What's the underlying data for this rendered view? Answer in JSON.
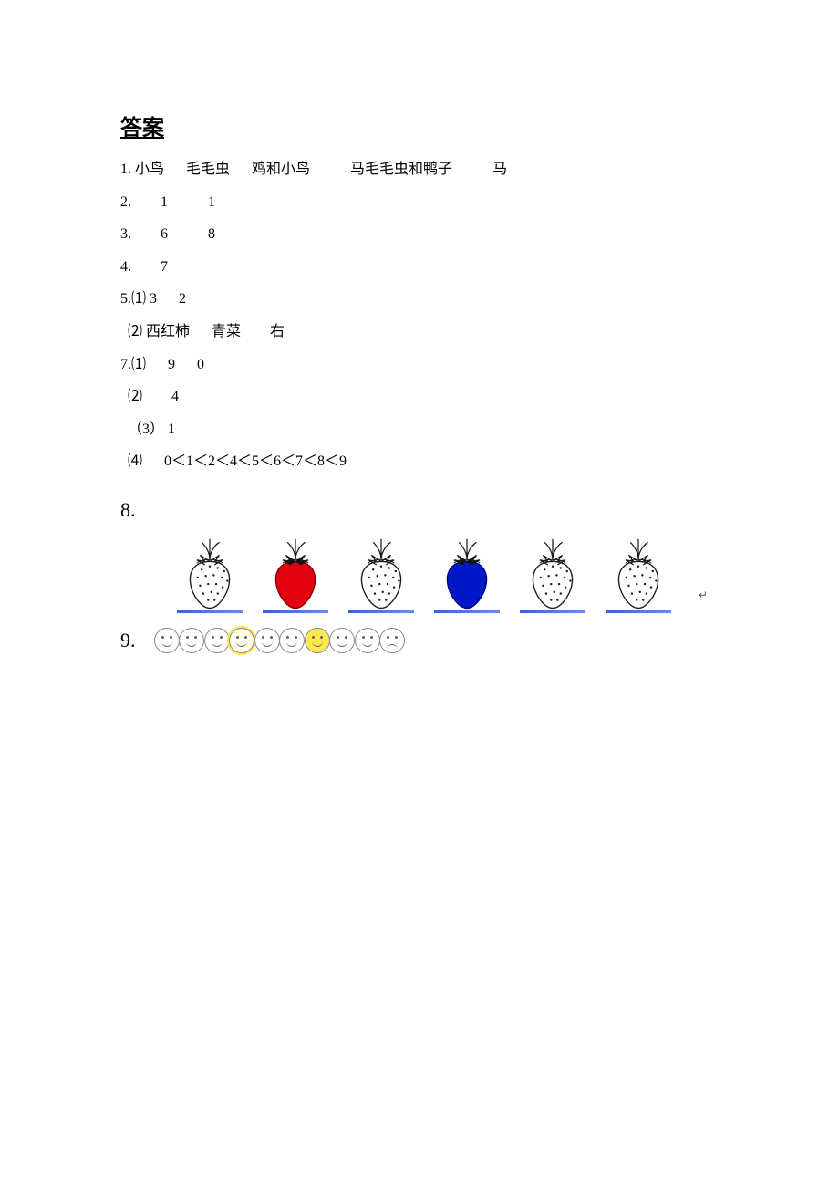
{
  "title": "答案",
  "q1": {
    "num": "1.",
    "a": "小鸟",
    "b": "毛毛虫",
    "c": "鸡和小鸟",
    "d": "马毛毛虫和鸭子",
    "e": "马"
  },
  "q2": {
    "num": "2.",
    "a": "1",
    "b": "1"
  },
  "q3": {
    "num": "3.",
    "a": "6",
    "b": "8"
  },
  "q4": {
    "num": "4.",
    "a": "7"
  },
  "q5": {
    "num": "5.",
    "part1_label": "⑴",
    "part1_a": "3",
    "part1_b": "2",
    "part2_label": "⑵",
    "part2_a": "西红柿",
    "part2_b": "青菜",
    "part2_c": "右"
  },
  "q7": {
    "num": "7.",
    "part1_label": "⑴",
    "part1_a": "9",
    "part1_b": "0",
    "part2_label": "⑵",
    "part2_a": "4",
    "part3_label": "（3）",
    "part3_a": "1",
    "part4_label": "⑷",
    "part4_a": "0＜1＜2＜4＜5＜6＜7＜8＜9"
  },
  "q8": {
    "num": "8.",
    "items": [
      {
        "fill": "outline"
      },
      {
        "fill": "red"
      },
      {
        "fill": "outline"
      },
      {
        "fill": "blue"
      },
      {
        "fill": "outline"
      },
      {
        "fill": "outline"
      }
    ],
    "tail": "↵"
  },
  "q9": {
    "num": "9.",
    "faces": [
      {
        "type": "smile",
        "boxed": false,
        "yellow": false
      },
      {
        "type": "smile",
        "boxed": false,
        "yellow": false
      },
      {
        "type": "smile",
        "boxed": false,
        "yellow": false
      },
      {
        "type": "smile",
        "boxed": true,
        "yellow": false
      },
      {
        "type": "smile",
        "boxed": false,
        "yellow": false
      },
      {
        "type": "smile",
        "boxed": false,
        "yellow": false
      },
      {
        "type": "smile",
        "boxed": false,
        "yellow": true
      },
      {
        "type": "smile",
        "boxed": false,
        "yellow": false
      },
      {
        "type": "smile",
        "boxed": false,
        "yellow": false
      },
      {
        "type": "sad",
        "boxed": false,
        "yellow": false
      }
    ]
  }
}
